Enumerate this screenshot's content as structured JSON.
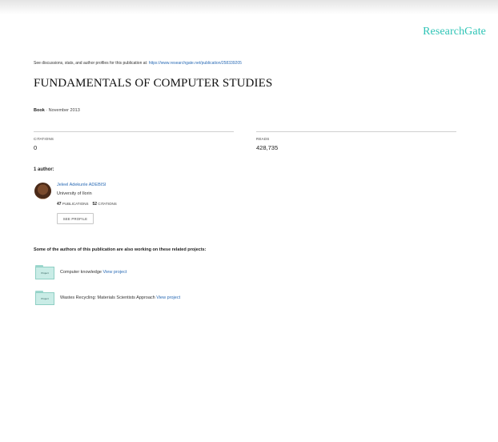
{
  "header": {
    "logo": "ResearchGate"
  },
  "discussion": {
    "text": "See discussions, stats, and author profiles for this publication at:",
    "link": "https://www.researchgate.net/publication/258339205"
  },
  "publication": {
    "title": "FUNDAMENTALS OF COMPUTER STUDIES",
    "type": "Book",
    "date": " · November 2013"
  },
  "stats": {
    "citations_label": "CITATIONS",
    "citations_value": "0",
    "reads_label": "READS",
    "reads_value": "428,735"
  },
  "authors": {
    "heading": "1 author:",
    "items": [
      {
        "name": "Jeleel Adekunle ADEBISI",
        "institution": "University of Ilorin",
        "publications_count": "47",
        "publications_label": "PUBLICATIONS",
        "citations_count": "52",
        "citations_label": "CITATIONS",
        "profile_button": "SEE PROFILE"
      }
    ]
  },
  "projects": {
    "heading": "Some of the authors of this publication are also working on these related projects:",
    "folder_label": "Project",
    "items": [
      {
        "name": "Computer knowledge",
        "link": "View project"
      },
      {
        "name": "Wastes Recycling: Materials Scientists Approach",
        "link": "View project"
      }
    ]
  },
  "colors": {
    "brand": "#2ec4b6",
    "link": "#2a6bb5"
  }
}
